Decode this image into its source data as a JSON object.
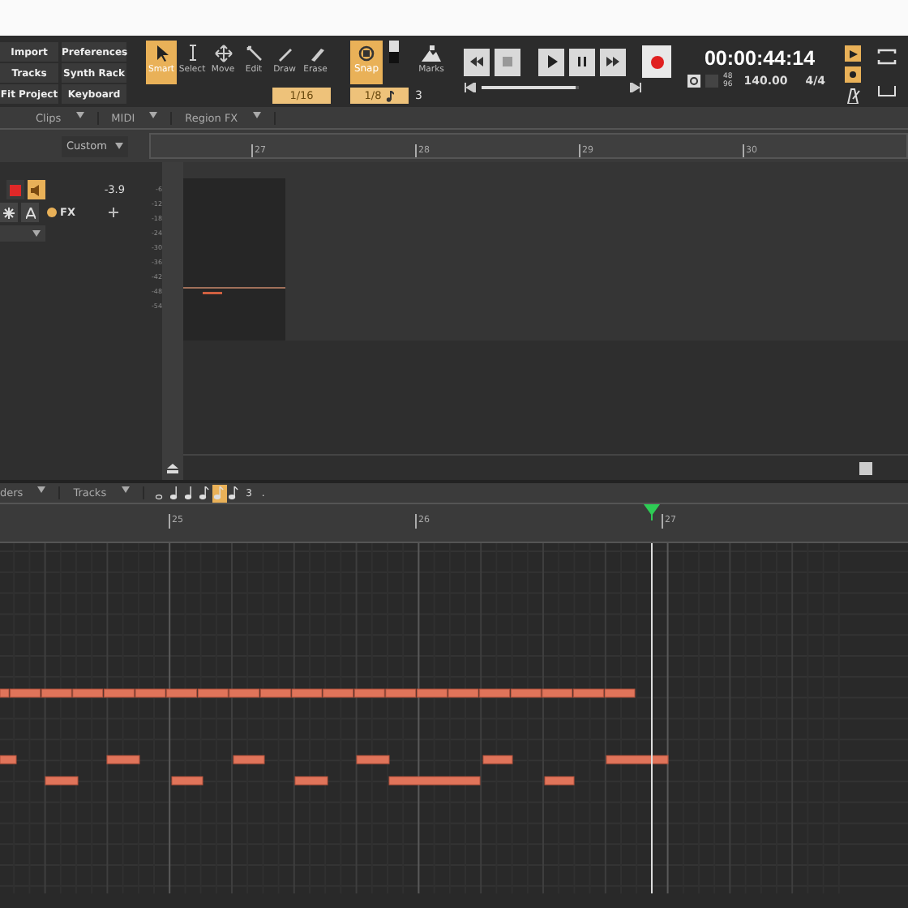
{
  "toolbar": {
    "project_buttons": [
      "Import",
      "Preferences",
      "Tracks",
      "Synth Rack",
      "Fit Project",
      "Keyboard"
    ],
    "tools": [
      {
        "label": "Smart",
        "kind": "smart",
        "selected": true
      },
      {
        "label": "Select",
        "kind": "select",
        "selected": false
      },
      {
        "label": "Move",
        "kind": "move",
        "selected": false
      },
      {
        "label": "Edit",
        "kind": "edit",
        "selected": false
      },
      {
        "label": "Draw",
        "kind": "draw",
        "selected": false
      },
      {
        "label": "Erase",
        "kind": "erase",
        "selected": false
      }
    ],
    "draw_resolution": "1/16",
    "snap": {
      "label": "Snap",
      "on": true,
      "value": "1/8",
      "count": "3"
    },
    "marks": {
      "label": "Marks"
    }
  },
  "transport": {
    "buttons": [
      {
        "kind": "rewind"
      },
      {
        "kind": "stop"
      },
      {
        "kind": "play"
      },
      {
        "kind": "pause"
      },
      {
        "kind": "forward"
      }
    ],
    "record_armed": true,
    "position": {
      "level": 0.97
    },
    "time": "00:00:44:14",
    "sample_rate": [
      "48",
      "96"
    ],
    "tempo": "140.00",
    "meter": "4/4"
  },
  "menus": [
    {
      "label": "Clips"
    },
    {
      "label": "MIDI"
    },
    {
      "label": "Region FX"
    }
  ],
  "track_view": {
    "preset": "Custom",
    "ruler": [
      "27",
      "28",
      "29",
      "30"
    ],
    "track": {
      "volume": "-3.9",
      "fx_label": "FX",
      "armed": true,
      "meter_scale": [
        "-6",
        "-12",
        "-18",
        "-24",
        "-30",
        "-36",
        "-42",
        "-48",
        "-54"
      ]
    }
  },
  "piano_roll": {
    "view_menu": "ders",
    "tracks_menu": "Tracks",
    "durations": [
      {
        "selected": false
      },
      {
        "selected": false
      },
      {
        "selected": false
      },
      {
        "selected": false
      },
      {
        "selected": true
      },
      {
        "selected": false
      }
    ],
    "triplet": "3",
    "dotted": ".",
    "ruler": [
      "25",
      "26",
      "27"
    ]
  }
}
